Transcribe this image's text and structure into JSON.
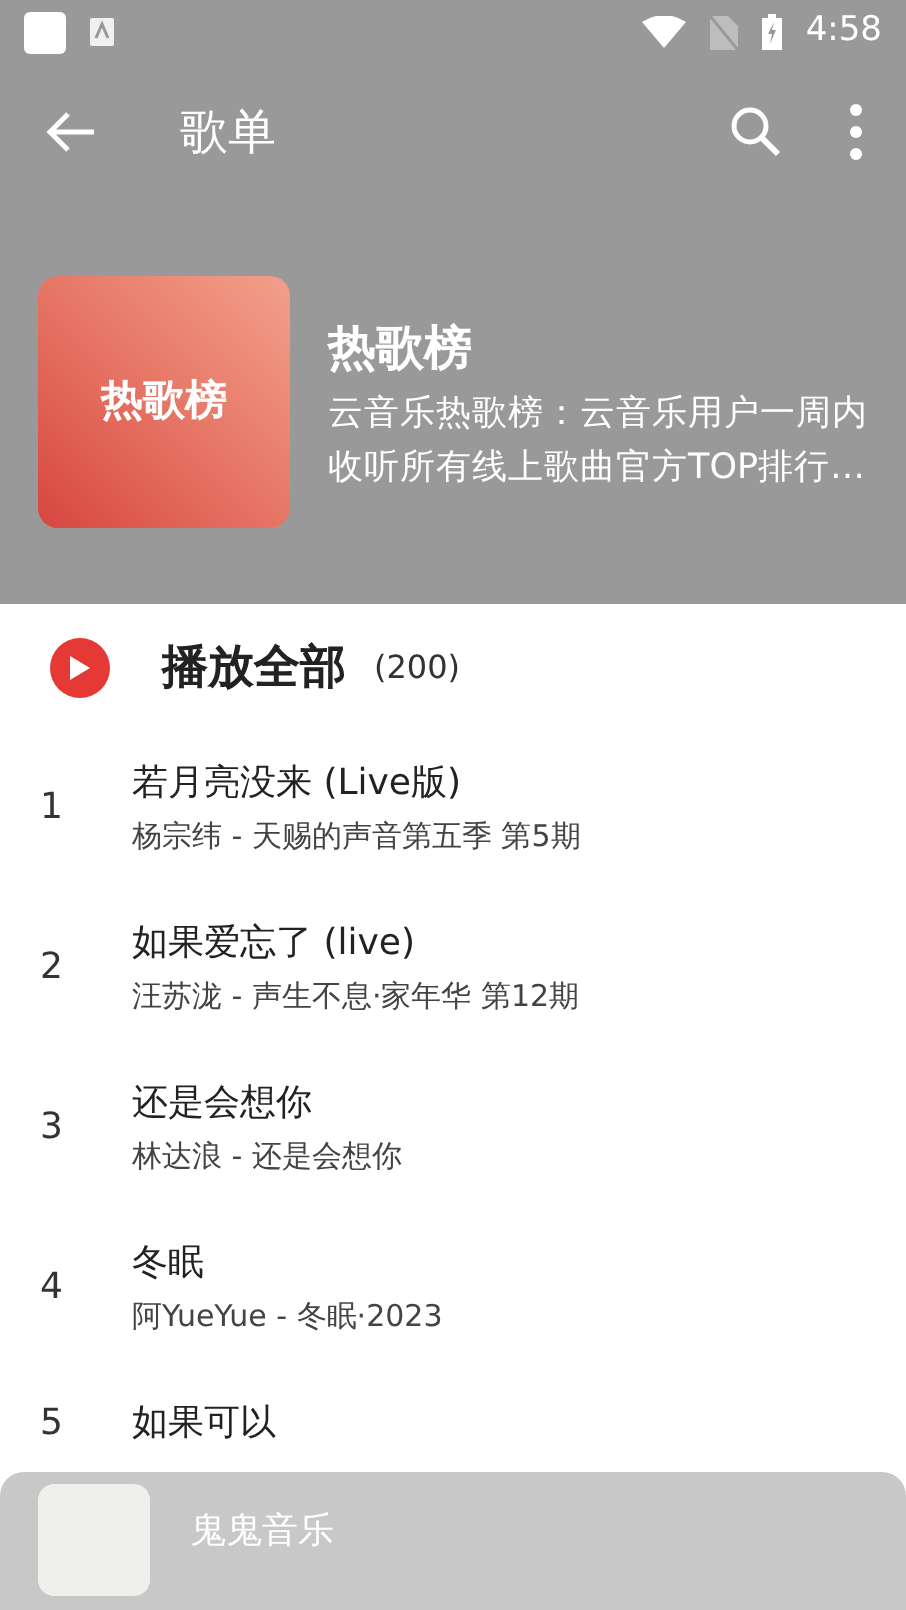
{
  "status_bar": {
    "time": "4:58"
  },
  "toolbar": {
    "title": "歌单"
  },
  "playlist": {
    "cover_text": "热歌榜",
    "title": "热歌榜",
    "description": "云音乐热歌榜：云音乐用户一周内收听所有线上歌曲官方TOP排行…"
  },
  "play_all": {
    "label": "播放全部",
    "count": "(200)"
  },
  "songs": [
    {
      "index": "1",
      "title": "若月亮没来 (Live版)",
      "subtitle": "杨宗纬 - 天赐的声音第五季 第5期"
    },
    {
      "index": "2",
      "title": "如果爱忘了 (live)",
      "subtitle": "汪苏泷 - 声生不息·家年华 第12期"
    },
    {
      "index": "3",
      "title": "还是会想你",
      "subtitle": "林达浪 - 还是会想你"
    },
    {
      "index": "4",
      "title": "冬眠",
      "subtitle": "阿YueYue - 冬眠·2023"
    },
    {
      "index": "5",
      "title": "如果可以"
    }
  ],
  "player": {
    "title": "鬼鬼音乐"
  }
}
